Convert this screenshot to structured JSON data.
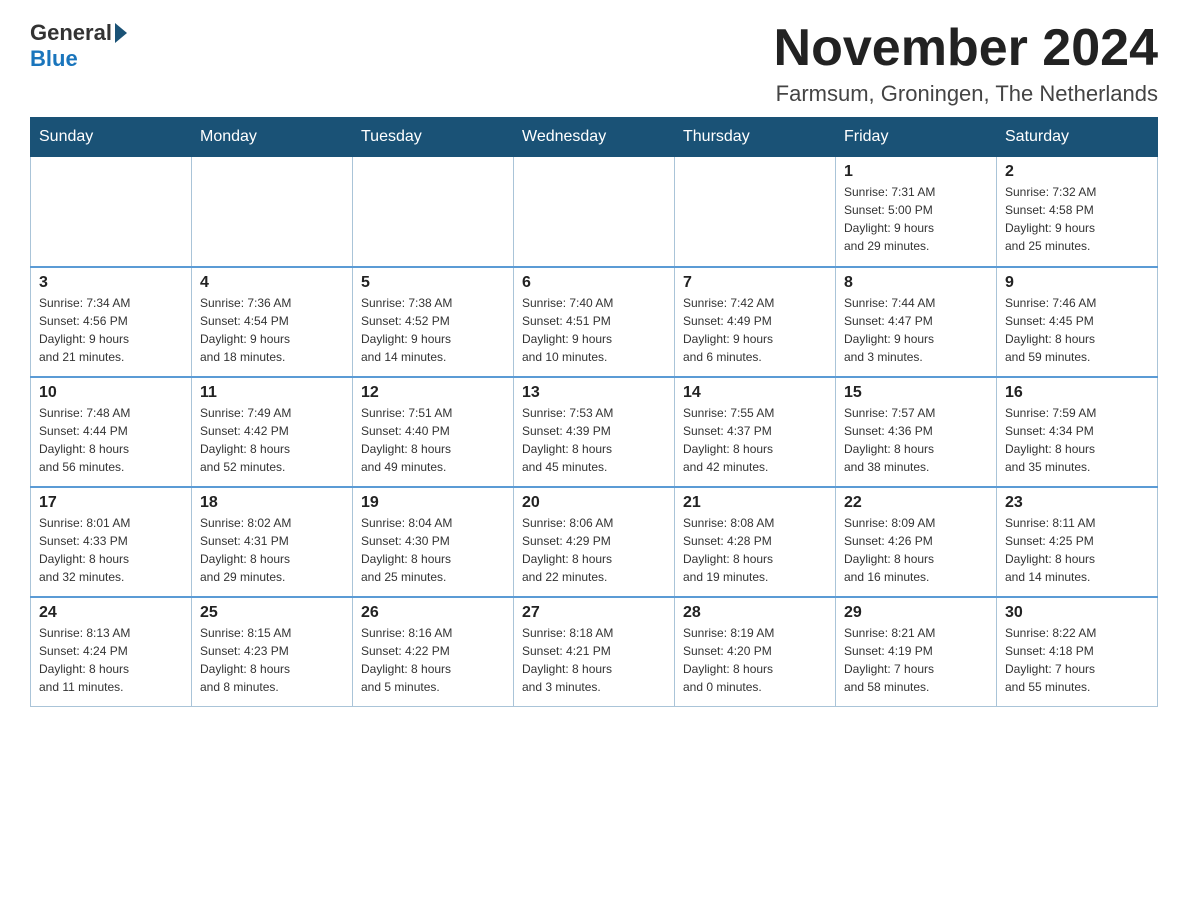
{
  "header": {
    "logo_general": "General",
    "logo_blue": "Blue",
    "month_title": "November 2024",
    "location": "Farmsum, Groningen, The Netherlands"
  },
  "weekdays": [
    "Sunday",
    "Monday",
    "Tuesday",
    "Wednesday",
    "Thursday",
    "Friday",
    "Saturday"
  ],
  "weeks": [
    [
      {
        "day": "",
        "info": ""
      },
      {
        "day": "",
        "info": ""
      },
      {
        "day": "",
        "info": ""
      },
      {
        "day": "",
        "info": ""
      },
      {
        "day": "",
        "info": ""
      },
      {
        "day": "1",
        "info": "Sunrise: 7:31 AM\nSunset: 5:00 PM\nDaylight: 9 hours\nand 29 minutes."
      },
      {
        "day": "2",
        "info": "Sunrise: 7:32 AM\nSunset: 4:58 PM\nDaylight: 9 hours\nand 25 minutes."
      }
    ],
    [
      {
        "day": "3",
        "info": "Sunrise: 7:34 AM\nSunset: 4:56 PM\nDaylight: 9 hours\nand 21 minutes."
      },
      {
        "day": "4",
        "info": "Sunrise: 7:36 AM\nSunset: 4:54 PM\nDaylight: 9 hours\nand 18 minutes."
      },
      {
        "day": "5",
        "info": "Sunrise: 7:38 AM\nSunset: 4:52 PM\nDaylight: 9 hours\nand 14 minutes."
      },
      {
        "day": "6",
        "info": "Sunrise: 7:40 AM\nSunset: 4:51 PM\nDaylight: 9 hours\nand 10 minutes."
      },
      {
        "day": "7",
        "info": "Sunrise: 7:42 AM\nSunset: 4:49 PM\nDaylight: 9 hours\nand 6 minutes."
      },
      {
        "day": "8",
        "info": "Sunrise: 7:44 AM\nSunset: 4:47 PM\nDaylight: 9 hours\nand 3 minutes."
      },
      {
        "day": "9",
        "info": "Sunrise: 7:46 AM\nSunset: 4:45 PM\nDaylight: 8 hours\nand 59 minutes."
      }
    ],
    [
      {
        "day": "10",
        "info": "Sunrise: 7:48 AM\nSunset: 4:44 PM\nDaylight: 8 hours\nand 56 minutes."
      },
      {
        "day": "11",
        "info": "Sunrise: 7:49 AM\nSunset: 4:42 PM\nDaylight: 8 hours\nand 52 minutes."
      },
      {
        "day": "12",
        "info": "Sunrise: 7:51 AM\nSunset: 4:40 PM\nDaylight: 8 hours\nand 49 minutes."
      },
      {
        "day": "13",
        "info": "Sunrise: 7:53 AM\nSunset: 4:39 PM\nDaylight: 8 hours\nand 45 minutes."
      },
      {
        "day": "14",
        "info": "Sunrise: 7:55 AM\nSunset: 4:37 PM\nDaylight: 8 hours\nand 42 minutes."
      },
      {
        "day": "15",
        "info": "Sunrise: 7:57 AM\nSunset: 4:36 PM\nDaylight: 8 hours\nand 38 minutes."
      },
      {
        "day": "16",
        "info": "Sunrise: 7:59 AM\nSunset: 4:34 PM\nDaylight: 8 hours\nand 35 minutes."
      }
    ],
    [
      {
        "day": "17",
        "info": "Sunrise: 8:01 AM\nSunset: 4:33 PM\nDaylight: 8 hours\nand 32 minutes."
      },
      {
        "day": "18",
        "info": "Sunrise: 8:02 AM\nSunset: 4:31 PM\nDaylight: 8 hours\nand 29 minutes."
      },
      {
        "day": "19",
        "info": "Sunrise: 8:04 AM\nSunset: 4:30 PM\nDaylight: 8 hours\nand 25 minutes."
      },
      {
        "day": "20",
        "info": "Sunrise: 8:06 AM\nSunset: 4:29 PM\nDaylight: 8 hours\nand 22 minutes."
      },
      {
        "day": "21",
        "info": "Sunrise: 8:08 AM\nSunset: 4:28 PM\nDaylight: 8 hours\nand 19 minutes."
      },
      {
        "day": "22",
        "info": "Sunrise: 8:09 AM\nSunset: 4:26 PM\nDaylight: 8 hours\nand 16 minutes."
      },
      {
        "day": "23",
        "info": "Sunrise: 8:11 AM\nSunset: 4:25 PM\nDaylight: 8 hours\nand 14 minutes."
      }
    ],
    [
      {
        "day": "24",
        "info": "Sunrise: 8:13 AM\nSunset: 4:24 PM\nDaylight: 8 hours\nand 11 minutes."
      },
      {
        "day": "25",
        "info": "Sunrise: 8:15 AM\nSunset: 4:23 PM\nDaylight: 8 hours\nand 8 minutes."
      },
      {
        "day": "26",
        "info": "Sunrise: 8:16 AM\nSunset: 4:22 PM\nDaylight: 8 hours\nand 5 minutes."
      },
      {
        "day": "27",
        "info": "Sunrise: 8:18 AM\nSunset: 4:21 PM\nDaylight: 8 hours\nand 3 minutes."
      },
      {
        "day": "28",
        "info": "Sunrise: 8:19 AM\nSunset: 4:20 PM\nDaylight: 8 hours\nand 0 minutes."
      },
      {
        "day": "29",
        "info": "Sunrise: 8:21 AM\nSunset: 4:19 PM\nDaylight: 7 hours\nand 58 minutes."
      },
      {
        "day": "30",
        "info": "Sunrise: 8:22 AM\nSunset: 4:18 PM\nDaylight: 7 hours\nand 55 minutes."
      }
    ]
  ]
}
